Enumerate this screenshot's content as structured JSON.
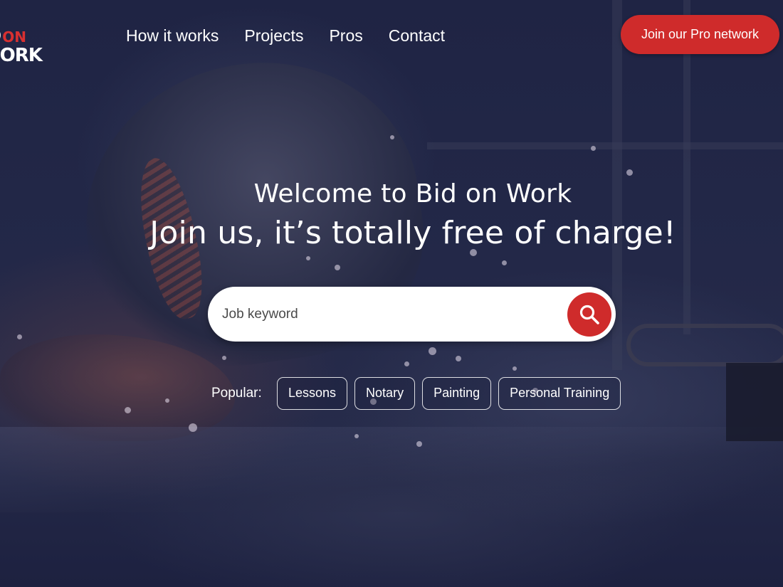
{
  "brand": {
    "logo_line1": "ID",
    "logo_on": "ON",
    "logo_line2": "WORK",
    "accent_color": "#cf2b2b"
  },
  "nav": {
    "items": [
      {
        "label": "How it works"
      },
      {
        "label": "Projects"
      },
      {
        "label": "Pros"
      },
      {
        "label": "Contact"
      }
    ]
  },
  "header": {
    "cta_label": "Join our Pro network"
  },
  "hero": {
    "welcome": "Welcome to Bid on Work",
    "tagline": "Join us, it’s totally free of charge!"
  },
  "search": {
    "placeholder": "Job keyword",
    "value": "",
    "button_icon": "search-icon"
  },
  "popular": {
    "label": "Popular:",
    "tags": [
      {
        "label": "Lessons"
      },
      {
        "label": "Notary"
      },
      {
        "label": "Painting"
      },
      {
        "label": "Personal Training"
      }
    ]
  }
}
